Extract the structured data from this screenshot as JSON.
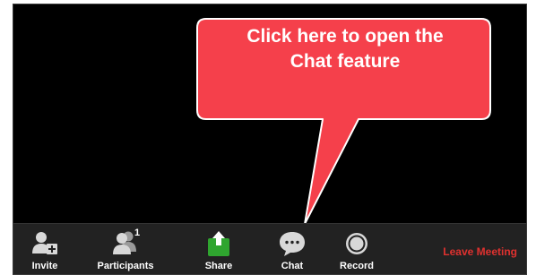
{
  "callout": {
    "text": "Click here to open the\nChat feature",
    "color": "#f5404b"
  },
  "toolbar": {
    "buttons": [
      {
        "label": "Invite",
        "icon": "invite-icon"
      },
      {
        "label": "Participants",
        "icon": "participants-icon",
        "badge": "1"
      },
      {
        "label": "Share",
        "icon": "share-icon",
        "color": "#2fa52f"
      },
      {
        "label": "Chat",
        "icon": "chat-icon"
      },
      {
        "label": "Record",
        "icon": "record-icon"
      }
    ],
    "leave_label": "Leave Meeting",
    "leave_color": "#e0312f"
  }
}
